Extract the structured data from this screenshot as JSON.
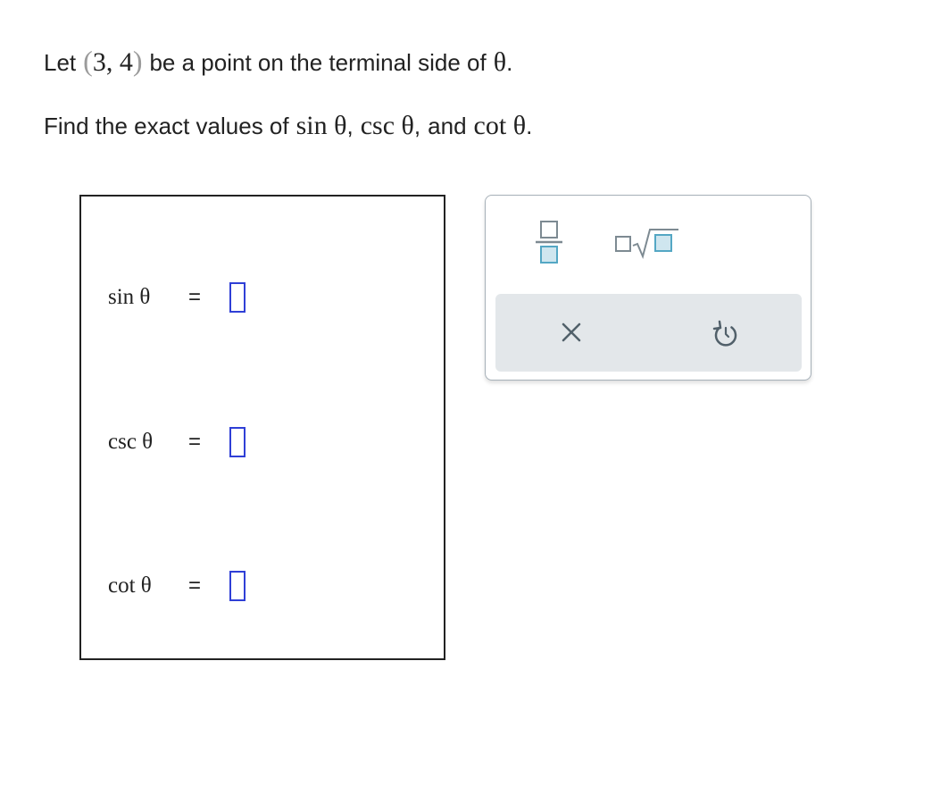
{
  "prompt": {
    "line1": {
      "text_before": "Let",
      "point_open": "(",
      "point_values": "3, 4",
      "point_close": ")",
      "text_after": "be a point on the terminal side of",
      "theta": "θ",
      "end": "."
    },
    "line2": {
      "text_before": "Find the exact values of",
      "sin": "sin θ",
      "comma1": ",",
      "csc": "csc θ",
      "comma2": ",",
      "and": "and",
      "cot": "cot θ",
      "end": "."
    }
  },
  "answers": {
    "rows": [
      {
        "label": "sin θ",
        "equals": "=",
        "value": ""
      },
      {
        "label": "csc θ",
        "equals": "=",
        "value": ""
      },
      {
        "label": "cot θ",
        "equals": "=",
        "value": ""
      }
    ]
  },
  "tools": {
    "fraction_icon": "fraction-icon",
    "sqrt_icon": "square-root-icon",
    "clear_icon": "close-icon",
    "undo_icon": "undo-icon"
  },
  "colors": {
    "input_border": "#2f3fd6",
    "tool_accent": "#54a7c4",
    "tool_gray": "#7d8a92",
    "action_bar_bg": "#e3e7ea",
    "paren_gray": "#9b9b9b"
  }
}
